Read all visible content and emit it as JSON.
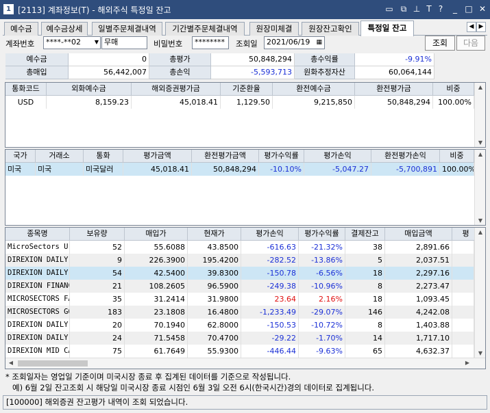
{
  "window": {
    "number": "1",
    "title": "[2113] 계좌정보(T) - 해외주식 특정일 잔고",
    "controls": [
      "▭",
      "⧉",
      "⊥",
      "T",
      "?",
      "_",
      "□",
      "✕"
    ]
  },
  "tabs": [
    "예수금",
    "예수금상세",
    "일별주문체결내역",
    "기간별주문체결내역",
    "원장미체결",
    "원장잔고확인",
    "특정일 잔고"
  ],
  "form": {
    "account_label": "계좌번호",
    "account_value": "****-**02",
    "account_type": "무매",
    "password_label": "비밀번호",
    "password_value": "********",
    "date_label": "조회일",
    "date_value": "2021/06/19",
    "search_button": "조회",
    "next_button": "다음"
  },
  "summary": {
    "deposit_label": "예수금",
    "deposit_value": "0",
    "total_eval_label": "총평가",
    "total_eval_value": "50,848,294",
    "total_return_label": "총수익률",
    "total_return_value": "-9.91%",
    "total_purchase_label": "총매입",
    "total_purchase_value": "56,442,007",
    "total_pl_label": "총손익",
    "total_pl_value": "-5,593,713",
    "krw_asset_label": "원화추정자산",
    "krw_asset_value": "60,064,144"
  },
  "currency_table": {
    "headers": [
      "통화코드",
      "외화예수금",
      "해외증권평가금",
      "기준환율",
      "환전예수금",
      "환전평가금",
      "비중"
    ],
    "rows": [
      [
        "USD",
        "8,159.23",
        "45,018.41",
        "1,129.50",
        "9,215,850",
        "50,848,294",
        "100.00%"
      ]
    ]
  },
  "country_table": {
    "headers": [
      "국가",
      "거래소",
      "통화",
      "평가금액",
      "환전평가금액",
      "평가수익률",
      "평가손익",
      "환전평가손익",
      "비중"
    ],
    "rows": [
      [
        "미국",
        "미국",
        "미국달러",
        "45,018.41",
        "50,848,294",
        "-10.10%",
        "-5,047.27",
        "-5,700,891",
        "100.00%"
      ]
    ]
  },
  "holdings_table": {
    "headers": [
      "종목명",
      "보유량",
      "매입가",
      "현재가",
      "평가손익",
      "평가수익률",
      "결제잔고",
      "매입금액",
      "평"
    ],
    "rows": [
      {
        "name": "MicroSectors U.",
        "qty": "52",
        "buy": "55.6088",
        "cur": "43.8500",
        "pl": "-616.63",
        "rate": "-21.32%",
        "settle": "38",
        "amount": "2,891.66",
        "sign": "neg"
      },
      {
        "name": "DIREXION DAILY",
        "qty": "9",
        "buy": "226.3900",
        "cur": "195.4200",
        "pl": "-282.52",
        "rate": "-13.86%",
        "settle": "5",
        "amount": "2,037.51",
        "sign": "neg"
      },
      {
        "name": "DIREXION DAILY",
        "qty": "54",
        "buy": "42.5400",
        "cur": "39.8300",
        "pl": "-150.78",
        "rate": "-6.56%",
        "settle": "18",
        "amount": "2,297.16",
        "sign": "neg"
      },
      {
        "name": "DIREXION FINANC",
        "qty": "21",
        "buy": "108.2605",
        "cur": "96.5900",
        "pl": "-249.38",
        "rate": "-10.96%",
        "settle": "8",
        "amount": "2,273.47",
        "sign": "neg"
      },
      {
        "name": "MICROSECTORS FA",
        "qty": "35",
        "buy": "31.2414",
        "cur": "31.9800",
        "pl": "23.64",
        "rate": "2.16%",
        "settle": "18",
        "amount": "1,093.45",
        "sign": "pos"
      },
      {
        "name": "MICROSECTORS GO",
        "qty": "183",
        "buy": "23.1808",
        "cur": "16.4800",
        "pl": "-1,233.49",
        "rate": "-29.07%",
        "settle": "146",
        "amount": "4,242.08",
        "sign": "neg"
      },
      {
        "name": "DIREXION DAILY",
        "qty": "20",
        "buy": "70.1940",
        "cur": "62.8000",
        "pl": "-150.53",
        "rate": "-10.72%",
        "settle": "8",
        "amount": "1,403.88",
        "sign": "neg"
      },
      {
        "name": "DIREXION DAILY",
        "qty": "24",
        "buy": "71.5458",
        "cur": "70.4700",
        "pl": "-29.22",
        "rate": "-1.70%",
        "settle": "14",
        "amount": "1,717.10",
        "sign": "neg"
      },
      {
        "name": "DIREXION MID CA",
        "qty": "75",
        "buy": "61.7649",
        "cur": "55.9300",
        "pl": "-446.44",
        "rate": "-9.63%",
        "settle": "65",
        "amount": "4,632.37",
        "sign": "neg"
      }
    ]
  },
  "notes": [
    "* 조회일자는 영업일 기준이며 미국시장 종료 후 집계된 데이터를 기준으로 작성됩니다.",
    "예) 6월 2일 잔고조회 시 해당일 미국시장 종료 시점인 6월 3일 오전 6시(한국시간)경의 데이터로 집계됩니다."
  ],
  "status_message": "[100000] 해외증권 잔고평가 내역이 조회 되었습니다.",
  "colors": {
    "titlebar": "#2f4d7c",
    "negative": "#1a2fd6",
    "positive": "#e01010",
    "selected_row": "#cde6f5"
  }
}
